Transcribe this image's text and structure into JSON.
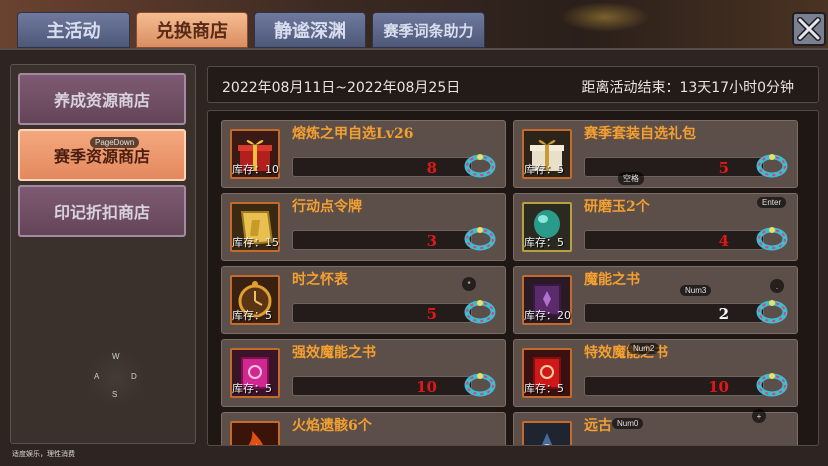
{
  "tabs": [
    {
      "label": "主活动"
    },
    {
      "label": "兑换商店"
    },
    {
      "label": "静谧深渊"
    },
    {
      "label": "赛季词条助力"
    }
  ],
  "sidebar": {
    "items": [
      {
        "label": "养成资源商店"
      },
      {
        "label": "赛季资源商店"
      },
      {
        "label": "印记折扣商店"
      }
    ]
  },
  "info": {
    "date_range": "2022年08月11日~2022年08月25日",
    "countdown": "距离活动结束：13天17小时0分钟"
  },
  "items": [
    {
      "name": "熔炼之甲自选Lv26",
      "stock": "库存：10",
      "price": "8",
      "icon": "gift-box-red-icon"
    },
    {
      "name": "赛季套装自选礼包",
      "stock": "库存：5",
      "price": "5",
      "icon": "gift-box-gold-icon"
    },
    {
      "name": "行动点令牌",
      "stock": "库存：15",
      "price": "3",
      "icon": "token-icon"
    },
    {
      "name": "研磨玉2个",
      "stock": "库存：5",
      "price": "4",
      "icon": "gem-icon"
    },
    {
      "name": "时之怀表",
      "stock": "库存：5",
      "price": "5",
      "icon": "pocket-watch-icon"
    },
    {
      "name": "魔能之书",
      "stock": "库存：20",
      "price": "2",
      "icon": "magic-book-purple-icon"
    },
    {
      "name": "强效魔能之书",
      "stock": "库存：5",
      "price": "10",
      "icon": "magic-book-pink-icon"
    },
    {
      "name": "特效魔能之书",
      "stock": "库存：5",
      "price": "10",
      "icon": "magic-book-red-icon"
    },
    {
      "name": "火焰遗骸6个",
      "stock": "",
      "price": "",
      "icon": "flame-remains-icon"
    },
    {
      "name": "远古",
      "stock": "",
      "price": "",
      "icon": "ancient-icon"
    }
  ],
  "key_hints": {
    "pagedown": "PageDown",
    "space": "空格",
    "enter": "Enter",
    "num3": "Num3",
    "num2": "Num2",
    "num0": "Num0",
    "asterisk": "*",
    "dot": ".",
    "plus": "+",
    "w": "W",
    "a": "A",
    "s": "S",
    "d": "D"
  },
  "footer": "适度娱乐，理性消费",
  "colors": {
    "active_tab": "#f5bd90",
    "tab": "#6f7a9e",
    "price_red": "#e01818",
    "item_name": "#f4a030"
  }
}
